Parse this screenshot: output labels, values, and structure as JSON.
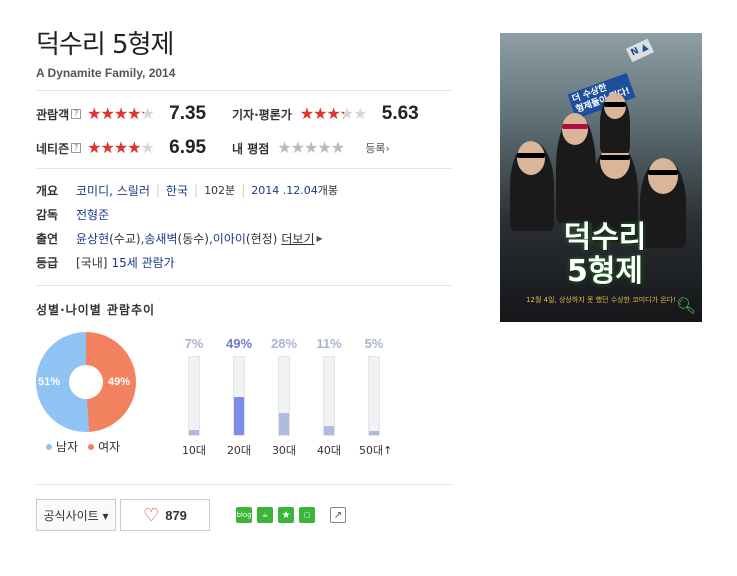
{
  "movie": {
    "title": "덕수리 5형제",
    "subtitle": "A Dynamite Family, 2014"
  },
  "ratings": {
    "audience": {
      "label": "관람객",
      "help": "?",
      "score": "7.35",
      "stars_fraction": 0.735
    },
    "critics": {
      "label": "기자·평론가",
      "score": "5.63",
      "stars_fraction": 0.563
    },
    "netizen": {
      "label": "네티즌",
      "help": "?",
      "score": "6.95",
      "stars_fraction": 0.695
    },
    "mine": {
      "label": "내 평점",
      "register": "등록›",
      "stars_fraction": 0
    }
  },
  "info": {
    "overview_label": "개요",
    "genres": "코미디, 스릴러",
    "country": "한국",
    "runtime": "102분",
    "release_date": "2014 .12.04",
    "release_suffix": "개봉",
    "director_label": "감독",
    "director": "전형준",
    "cast_label": "출연",
    "cast": [
      "윤상현",
      "(수교), ",
      "송새벽",
      "(동수), ",
      "이아이",
      "(현정)"
    ],
    "more": "더보기",
    "grade_label": "등급",
    "grade_prefix": "[국내]",
    "grade": "15세 관람가"
  },
  "demographics": {
    "section_title": "성별·나이별 관람추이",
    "gender": {
      "male_pct": 51,
      "female_pct": 49,
      "male_label": "51%",
      "female_label": "49%",
      "male_legend": "남자",
      "female_legend": "여자",
      "male_color": "#8ec3f3",
      "female_color": "#f28160"
    },
    "ages": [
      {
        "label": "10대",
        "pct": 7,
        "pct_label": "7%",
        "highlight": false
      },
      {
        "label": "20대",
        "pct": 49,
        "pct_label": "49%",
        "highlight": true
      },
      {
        "label": "30대",
        "pct": 28,
        "pct_label": "28%",
        "highlight": false
      },
      {
        "label": "40대",
        "pct": 11,
        "pct_label": "11%",
        "highlight": false
      },
      {
        "label": "50대↑",
        "pct": 5,
        "pct_label": "5%",
        "highlight": false
      }
    ]
  },
  "actions": {
    "official_site": "공식사이트 ▾",
    "likes": "879",
    "share_icons": [
      "blog",
      "cafe",
      "bookmark",
      "me",
      "share"
    ]
  },
  "poster": {
    "title_line1": "덕수리",
    "title_line2": "5형제",
    "sign1": "더 수상한\n형제들이 떴다!",
    "caption": "12월 4일, 상상하지 못 했던 수상한 코미디가 온다!"
  }
}
